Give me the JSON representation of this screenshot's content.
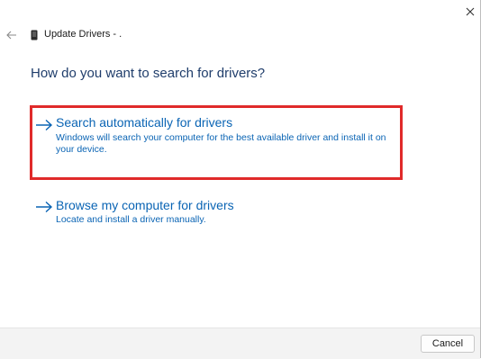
{
  "window": {
    "title": "Update Drivers - ."
  },
  "heading": "How do you want to search for drivers?",
  "options": [
    {
      "title": "Search automatically for drivers",
      "description": "Windows will search your computer for the best available driver and install it on your device.",
      "highlighted": true
    },
    {
      "title": "Browse my computer for drivers",
      "description": "Locate and install a driver manually.",
      "highlighted": false
    }
  ],
  "footer": {
    "cancel_label": "Cancel"
  },
  "colors": {
    "link": "#0a64b4",
    "heading": "#1f3d6b",
    "highlight_border": "#e02a2a",
    "footer_bg": "#f3f3f3"
  },
  "icons": {
    "close": "close-icon",
    "back": "back-arrow-icon",
    "device": "device-icon",
    "option_arrow": "arrow-right-icon"
  }
}
